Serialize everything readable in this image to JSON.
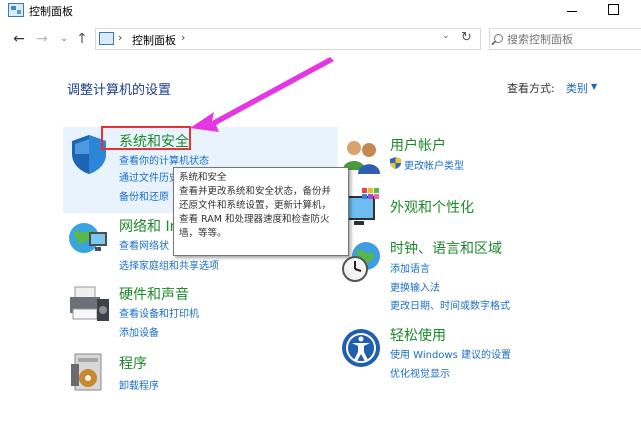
{
  "window": {
    "title": "控制面板"
  },
  "nav": {
    "back": "←",
    "forward": "→",
    "recent": "⌄",
    "up": "↑"
  },
  "address": {
    "separator": "›",
    "location": "控制面板",
    "refresh": "↻",
    "dropdown": "⌄"
  },
  "search": {
    "placeholder": "搜索控制面板"
  },
  "header": {
    "title": "调整计算机的设置",
    "view_by_label": "查看方式:",
    "view_by_value": "类别",
    "view_by_arrow": "▼"
  },
  "categories": [
    {
      "title": "系统和安全",
      "icon": "shield-icon",
      "links": [
        "查看你的计算机状态",
        "通过文件历史",
        "备份和还原"
      ]
    },
    {
      "title": "网络和 Int",
      "icon": "network-globe-icon",
      "links": [
        "查看网络状",
        "选择家庭组和共享选项"
      ]
    },
    {
      "title": "硬件和声音",
      "icon": "printer-icon",
      "links": [
        "查看设备和打印机",
        "添加设备"
      ]
    },
    {
      "title": "程序",
      "icon": "programs-disk-icon",
      "links": [
        "卸载程序"
      ]
    },
    {
      "title": "用户帐户",
      "icon": "users-icon",
      "links": [
        "更改帐户类型"
      ],
      "link_icon": "uac-shield-icon"
    },
    {
      "title": "外观和个性化",
      "icon": "display-palette-icon",
      "links": []
    },
    {
      "title": "时钟、语言和区域",
      "icon": "clock-globe-icon",
      "links": [
        "添加语言",
        "更换输入法",
        "更改日期、时间或数字格式"
      ]
    },
    {
      "title": "轻松使用",
      "icon": "ease-of-access-icon",
      "links": [
        "使用 Windows 建议的设置",
        "优化视觉显示"
      ]
    }
  ],
  "tooltip": {
    "title": "系统和安全",
    "lines": [
      "查看并更改系统和安全状态，备份并",
      "还原文件和系统设置，更新计算机，",
      "查看 RAM 和处理器速度和检查防火",
      "墙，等等。"
    ]
  },
  "colors": {
    "highlight_box": "#e53333",
    "arrow": "#e535e5",
    "category_title": "#1d8a2a",
    "link": "#1a6ec8"
  }
}
